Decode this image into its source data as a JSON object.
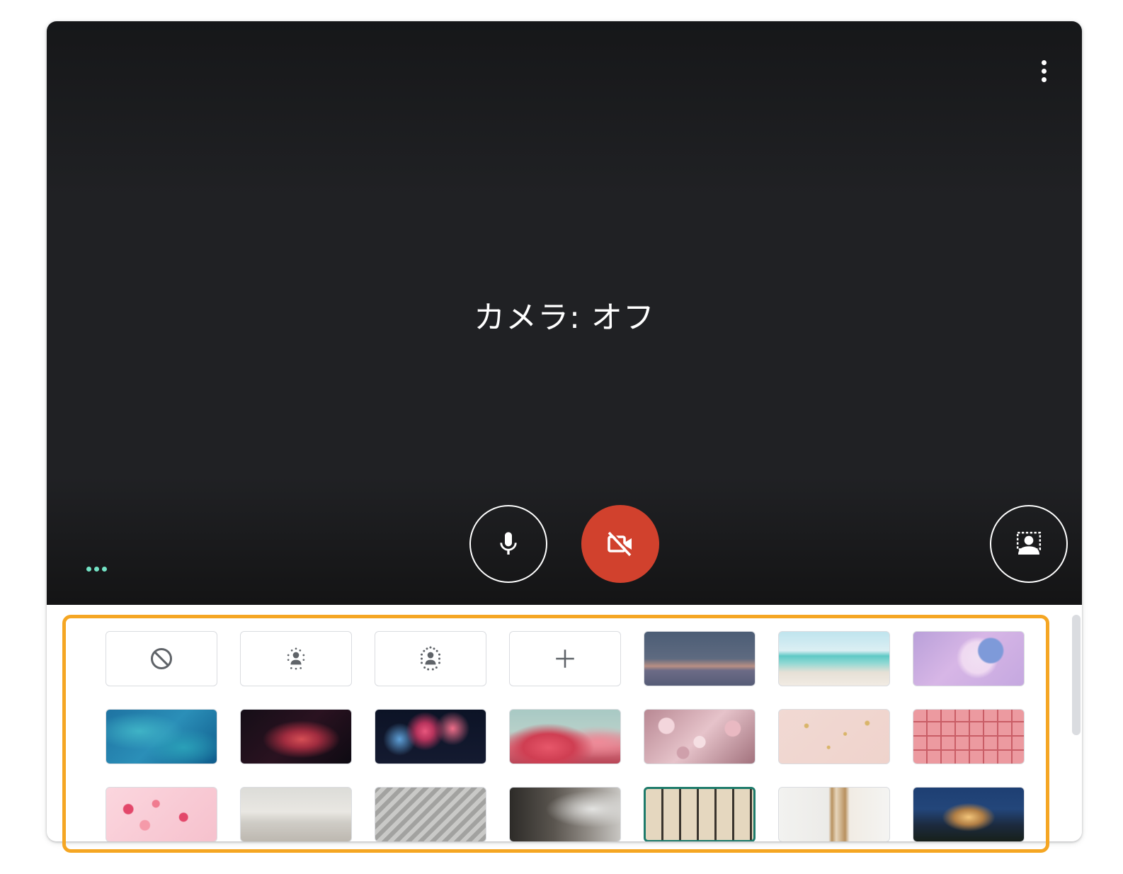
{
  "video": {
    "camera_status": "カメラ: オフ",
    "menu_icon": "more-vert-icon",
    "mic_icon": "mic-icon",
    "camera_icon": "videocam-off-icon",
    "background_icon": "background-replace-icon",
    "audio_indicator_color": "#73e2c4",
    "camera_off_color": "#d1412d"
  },
  "background_panel": {
    "options": [
      {
        "name": "no-effect",
        "icon": "block-icon"
      },
      {
        "name": "slight-blur",
        "icon": "blur-slight-icon"
      },
      {
        "name": "blur",
        "icon": "blur-icon"
      },
      {
        "name": "add-image",
        "icon": "add-icon"
      }
    ],
    "backgrounds": [
      "dusk-horizon",
      "tropical-beach",
      "pastel-clouds",
      "water-caustics",
      "red-nebula",
      "fireworks",
      "pink-flowers-sky",
      "rose-wall",
      "pink-gold-confetti",
      "pink-pattern",
      "pink-confetti",
      "white-office",
      "modern-interior",
      "dark-living-room",
      "bookshelf",
      "wall-shelves",
      "lit-house-night"
    ],
    "selected_background": "bookshelf",
    "highlight_color": "#f5a623"
  }
}
